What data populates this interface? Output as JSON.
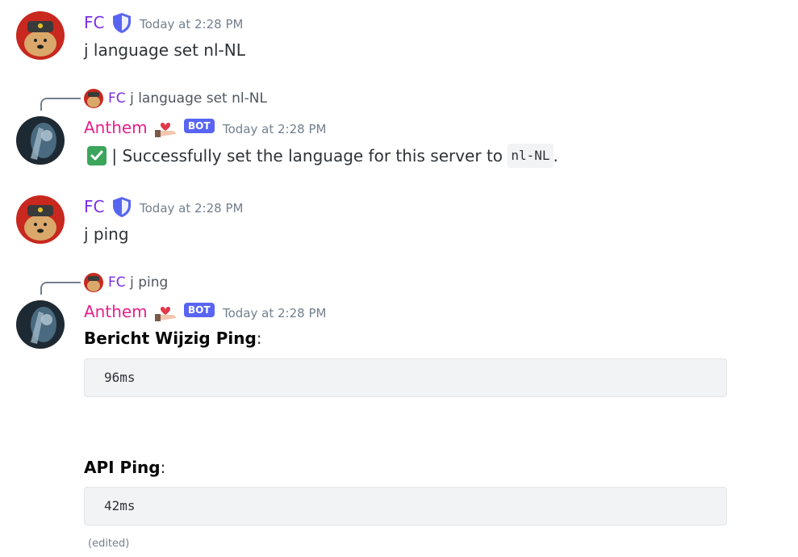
{
  "messages": [
    {
      "author": "FC",
      "timestamp": "Today at 2:28 PM",
      "content": "j language set nl-NL"
    },
    {
      "reply": {
        "author": "FC",
        "content": "j language set nl-NL"
      },
      "author": "Anthem",
      "bot_tag": "BOT",
      "timestamp": "Today at 2:28 PM",
      "content_prefix": " | Successfully set the language for this server to ",
      "content_code": "nl-NL",
      "content_suffix": "."
    },
    {
      "author": "FC",
      "timestamp": "Today at 2:28 PM",
      "content": "j ping"
    },
    {
      "reply": {
        "author": "FC",
        "content": "j ping"
      },
      "author": "Anthem",
      "bot_tag": "BOT",
      "timestamp": "Today at 2:28 PM",
      "fields": [
        {
          "name": "Bericht Wijzig Ping",
          "colon": ":",
          "value": "96ms"
        },
        {
          "name": "API Ping",
          "colon": ":",
          "value": "42ms"
        }
      ],
      "edited": "(edited)"
    }
  ],
  "icons": {
    "shield": "shield-icon",
    "check": "white-check-mark-icon",
    "hand_heart": "hand-with-heart-icon"
  },
  "colors": {
    "fc_name": "#7d2ee6",
    "anthem_name": "#e91e8c",
    "bot_tag": "#5865f2",
    "timestamp": "#747f8d",
    "check": "#3ba55c"
  }
}
